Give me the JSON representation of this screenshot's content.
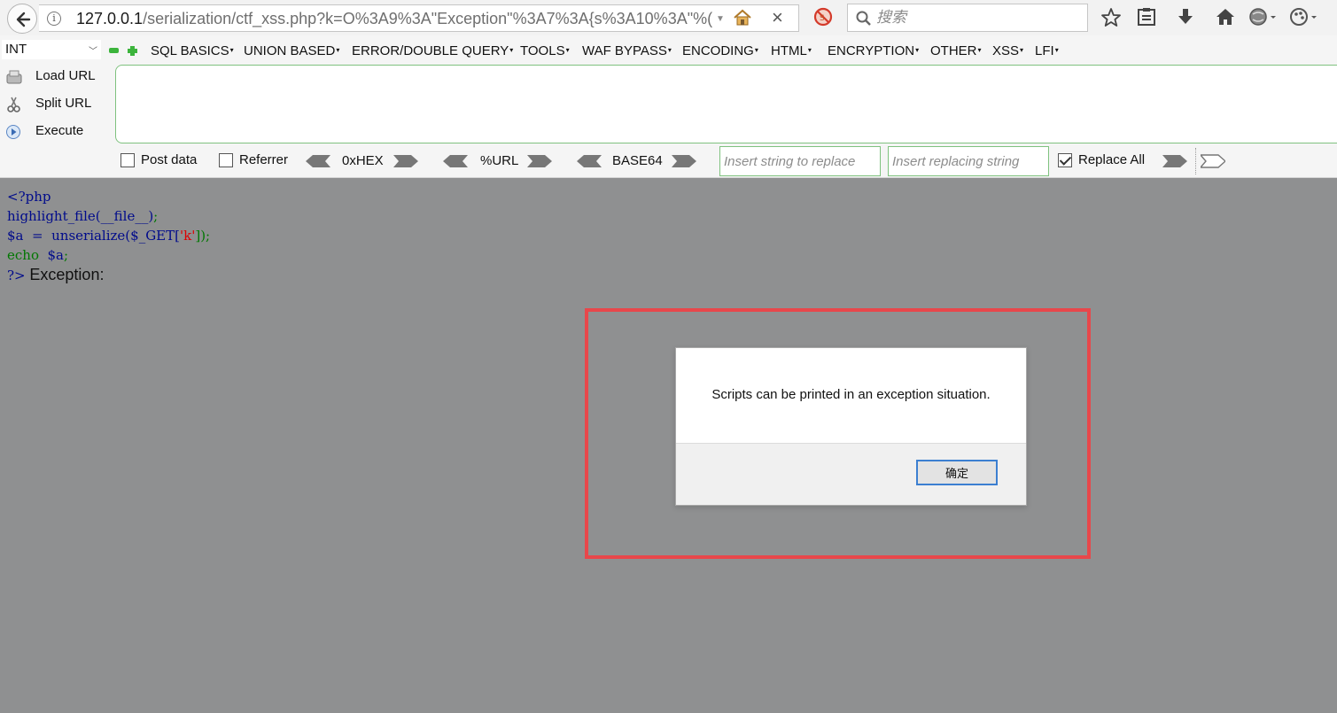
{
  "browser": {
    "url_host": "127.0.0.1",
    "url_path": "/serialization/ctf_xss.php?k=O%3A9%3A\"Exception\"%3A7%3A{s%3A10%3A\"%(",
    "search_placeholder": "搜索",
    "info_icon": "i"
  },
  "hackbar": {
    "select_value": "INT",
    "menus": [
      "SQL BASICS",
      "UNION BASED",
      "ERROR/DOUBLE QUERY",
      "TOOLS",
      "WAF BYPASS",
      "ENCODING",
      "HTML",
      "ENCRYPTION",
      "OTHER",
      "XSS",
      "LFI"
    ],
    "load_url": "Load URL",
    "split_url": "Split URL",
    "execute": "Execute",
    "post_data": "Post data",
    "referrer": "Referrer",
    "hex": "0xHEX",
    "url_enc": "%URL",
    "base64": "BASE64",
    "replace_placeholder": "Insert string to replace",
    "replacing_placeholder": "Insert replacing string",
    "replace_all": "Replace All"
  },
  "code": {
    "line1": "<?php",
    "line2_fn": "highlight_file(__file__)",
    "line2_end": ";",
    "line3_var": "$a  =  unserialize($_GET[",
    "line3_str": "'k'",
    "line3_end": "]);",
    "line4_kw": "echo  ",
    "line4_var": "$a",
    "line4_end": ";",
    "line5_close": "?>",
    "line5_output": "Exception:"
  },
  "alert": {
    "message": "Scripts can be printed in an exception situation.",
    "ok_label": "确定"
  },
  "colors": {
    "highlight_border": "#e8474b",
    "page_background": "#8f9091",
    "hackbar_green": "#3cb43c"
  }
}
